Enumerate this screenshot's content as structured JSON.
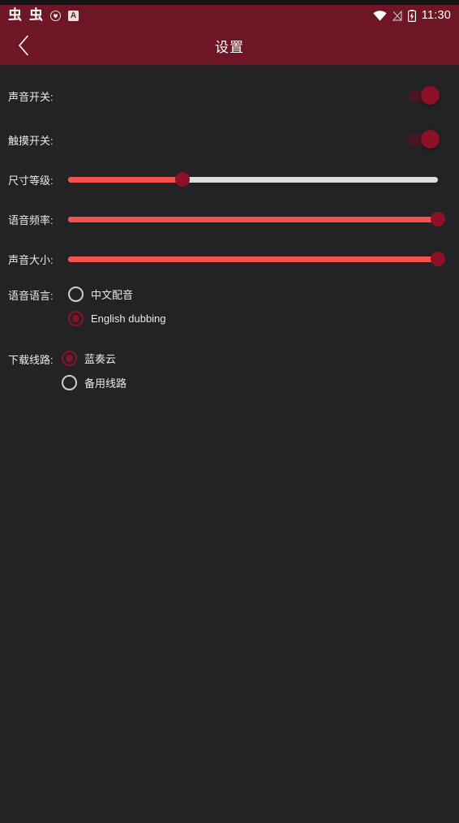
{
  "colors": {
    "header_bg": "#6e1626",
    "page_bg": "#232325",
    "accent_red": "#f1534c",
    "accent_dark_red": "#8d1126",
    "track_gray": "#dedede",
    "text": "#e9e9e9"
  },
  "status_bar": {
    "notifications": [
      {
        "icon": "bug-icon",
        "glyph": "虫"
      },
      {
        "icon": "bug-icon",
        "glyph": "虫"
      },
      {
        "icon": "shield-heart-icon"
      },
      {
        "icon": "letter-a-badge-icon",
        "glyph": "A"
      }
    ],
    "wifi_icon": "wifi-icon",
    "signal_off_icon": "signal-no-sim-icon",
    "battery_icon": "battery-charging-icon",
    "time": "11:30"
  },
  "app_bar": {
    "back_icon": "chevron-left-icon",
    "title": "设置"
  },
  "settings": {
    "sound_switch": {
      "label": "声音开关:",
      "type": "toggle",
      "value": "on"
    },
    "touch_switch": {
      "label": "触摸开关:",
      "type": "toggle",
      "value": "on"
    },
    "size_level": {
      "label": "尺寸等级:",
      "type": "slider",
      "percent": 31
    },
    "voice_rate": {
      "label": "语音频率:",
      "type": "slider",
      "percent": 100
    },
    "volume": {
      "label": "声音大小:",
      "type": "slider",
      "percent": 100
    },
    "voice_language": {
      "label": "语音语言:",
      "type": "radio-group",
      "options": [
        {
          "label": "中文配音",
          "selected": false
        },
        {
          "label": "English dubbing",
          "selected": true
        }
      ]
    },
    "download_route": {
      "label": "下载线路:",
      "type": "radio-group",
      "options": [
        {
          "label": "蓝奏云",
          "selected": true
        },
        {
          "label": "备用线路",
          "selected": false
        }
      ]
    }
  }
}
